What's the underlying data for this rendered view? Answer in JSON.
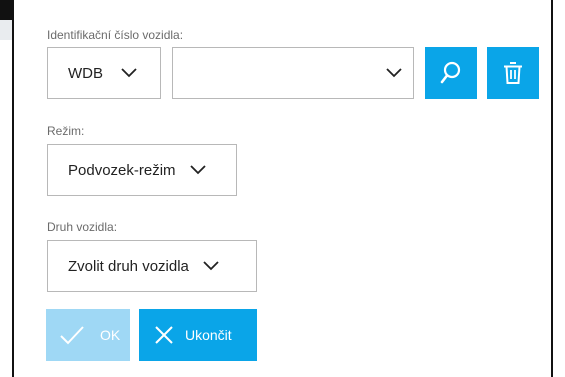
{
  "form": {
    "vin_label": "Identifikační číslo vozidla:",
    "vin_prefix_value": "WDB",
    "vin_number_value": "",
    "mode_label": "Režim:",
    "mode_value": "Podvozek-režim",
    "vehicle_type_label": "Druh vozidla:",
    "vehicle_type_value": "Zvolit druh vozidla"
  },
  "buttons": {
    "ok_label": "OK",
    "cancel_label": "Ukončit"
  },
  "icons": {
    "search": "search-icon",
    "delete": "trash-icon",
    "ok": "checkmark-icon",
    "cancel": "close-icon",
    "dropdown": "chevron-down-icon"
  },
  "colors": {
    "primary": "#0aa5e8",
    "disabled": "#9fd8f5",
    "border": "#b8b8b8",
    "label": "#6b6b6b"
  }
}
